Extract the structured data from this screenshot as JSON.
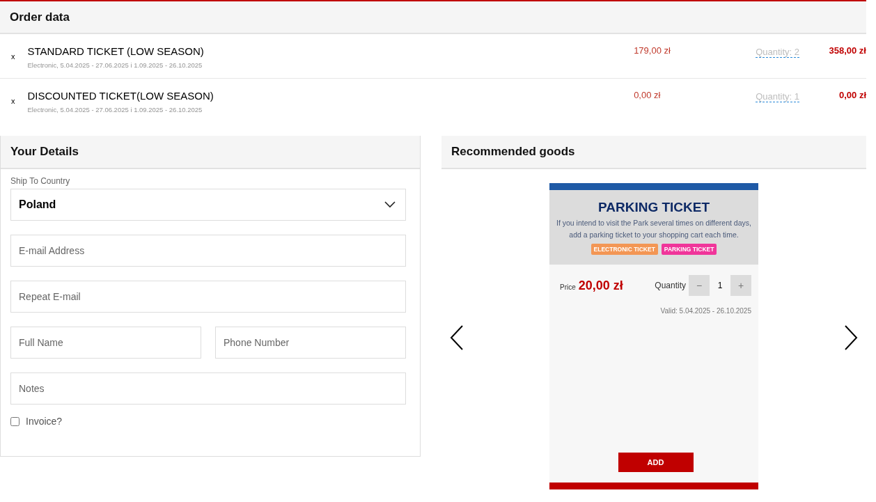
{
  "order": {
    "title": "Order data",
    "items": [
      {
        "remove": "x",
        "name": "STANDARD TICKET (LOW SEASON)",
        "details": "Electronic, 5.04.2025 - 27.06.2025 i 1.09.2025 - 26.10.2025",
        "price": "179,00 zł",
        "quantity": "Quantity: 2",
        "total": "358,00 zł"
      },
      {
        "remove": "x",
        "name": "DISCOUNTED TICKET(LOW SEASON)",
        "details": "Electronic, 5.04.2025 - 27.06.2025 i 1.09.2025 - 26.10.2025",
        "price": "0,00 zł",
        "quantity": "Quantity: 1",
        "total": "0,00 zł"
      }
    ]
  },
  "details": {
    "title": "Your Details",
    "country_label": "Ship To Country",
    "country": "Poland",
    "fields": [
      {
        "placeholder": "E-mail Address"
      },
      {
        "placeholder": "Repeat E-mail"
      },
      {
        "placeholder": "Full Name"
      },
      {
        "placeholder": "Phone Number"
      },
      {
        "placeholder": "Notes"
      }
    ],
    "invoice": {
      "label": "Invoice?",
      "checked": false
    }
  },
  "recommended": {
    "title": "Recommended goods",
    "product": {
      "name": "PARKING TICKET",
      "description": "If you intend to visit the Park several times on different days, add a parking ticket to your shopping cart each time.",
      "tags": [
        {
          "label": "ELECTRONIC TICKET",
          "color": "#f39654"
        },
        {
          "label": "PARKING TICKET",
          "color": "#f0359a"
        }
      ],
      "price_label": "Price",
      "price": "20,00 zł",
      "quantity_label": "Quantity",
      "minus": "−",
      "quantity": "1",
      "plus": "+",
      "valid": "Valid: 5.04.2025 - 26.10.2025",
      "button": "ADD"
    }
  }
}
